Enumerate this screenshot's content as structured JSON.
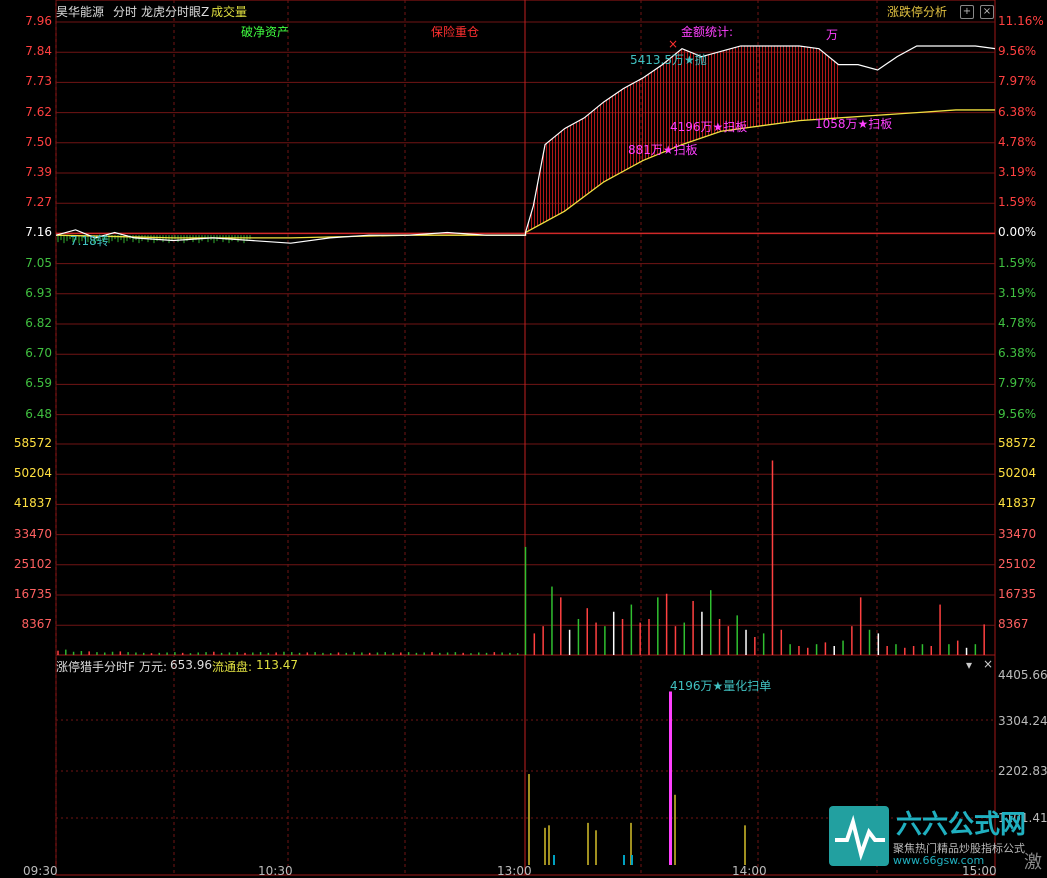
{
  "header": {
    "stock_name": "昊华能源",
    "view_mode": "分时",
    "indicator_name": "龙虎分时眼Z",
    "volume_label": "成交量",
    "analysis_button": "涨跌停分析",
    "add_button": "+",
    "close_button": "×"
  },
  "price_axis": {
    "labels": [
      "7.96",
      "7.84",
      "7.73",
      "7.62",
      "7.50",
      "7.39",
      "7.27",
      "7.16",
      "7.05",
      "6.93",
      "6.82",
      "6.70",
      "6.59",
      "6.48"
    ],
    "pct_labels": [
      "11.16%",
      "9.56%",
      "7.97%",
      "6.38%",
      "4.78%",
      "3.19%",
      "1.59%",
      "0.00%",
      "1.59%",
      "3.19%",
      "4.78%",
      "6.38%",
      "7.97%",
      "9.56%"
    ],
    "prev_close": 7.16,
    "up_color": "#ff4040",
    "down_color": "#40c040",
    "flat_color": "#ffffff"
  },
  "volume_axis": {
    "labels": [
      "58572",
      "50204",
      "41837",
      "33470",
      "25102",
      "16735",
      "8367"
    ]
  },
  "annotations": {
    "net_asset": "破净资产",
    "insurance": "保险重仓",
    "amount_stats": "金额统计:",
    "wan": "万",
    "buy_signal": "7.18转",
    "sell_signal": "5413.5万★抛",
    "sweep_1": "4196万★扫板",
    "sweep_2": "881万★扫板",
    "sweep_3": "1058万★扫板"
  },
  "indicator": {
    "title": "涨停猎手分时F",
    "wan_label": "万元:",
    "wan_value": "653.96",
    "float_label": "流通盘:",
    "float_value": "113.47",
    "axis_labels": [
      "4405.66",
      "3304.24",
      "2202.83",
      "1101.41"
    ],
    "quant_sweep": "4196万★量化扫单",
    "dropdown": "▾",
    "close": "×"
  },
  "time_axis": [
    "09:30",
    "10:30",
    "13:00",
    "14:00",
    "15:00"
  ],
  "watermark": {
    "brand": "六六公式网",
    "slogan": "聚焦热门精品炒股指标公式",
    "url": "www.66gsw.com",
    "footer_text": "激"
  },
  "chart_data": {
    "type": "line",
    "title": "",
    "ylim": [
      6.42,
      7.96
    ],
    "series": [
      {
        "name": "",
        "x": [
          "09:30",
          "09:35",
          "09:40",
          "09:45",
          "09:50",
          "10:00",
          "10:10",
          "10:20",
          "10:30",
          "10:40",
          "10:50",
          "11:00",
          "11:10",
          "11:20",
          "11:30",
          "13:00",
          "13:02",
          "13:05",
          "13:10",
          "13:15",
          "13:20",
          "13:25",
          "13:30",
          "13:35",
          "13:40",
          "13:45",
          "13:50",
          "13:55",
          "14:00",
          "14:05",
          "14:10",
          "14:15",
          "14:20",
          "14:25",
          "14:30",
          "14:35",
          "14:40",
          "14:45",
          "14:50",
          "14:55",
          "15:00"
        ],
        "values": [
          7.16,
          7.18,
          7.15,
          7.17,
          7.15,
          7.14,
          7.15,
          7.14,
          7.13,
          7.15,
          7.16,
          7.16,
          7.17,
          7.16,
          7.16,
          7.17,
          7.27,
          7.5,
          7.56,
          7.6,
          7.66,
          7.71,
          7.75,
          7.8,
          7.86,
          7.83,
          7.85,
          7.87,
          7.87,
          7.87,
          7.87,
          7.86,
          7.8,
          7.8,
          7.78,
          7.83,
          7.87,
          7.87,
          7.87,
          7.87,
          7.86
        ]
      },
      {
        "name": "",
        "x": [
          "09:30",
          "10:00",
          "10:30",
          "11:00",
          "11:30",
          "13:00",
          "13:10",
          "13:20",
          "13:30",
          "13:40",
          "13:50",
          "14:00",
          "14:10",
          "14:20",
          "14:30",
          "14:40",
          "14:50",
          "15:00"
        ],
        "values": [
          7.16,
          7.15,
          7.15,
          7.16,
          7.16,
          7.17,
          7.25,
          7.36,
          7.44,
          7.5,
          7.55,
          7.57,
          7.59,
          7.6,
          7.61,
          7.62,
          7.63,
          7.63
        ]
      }
    ],
    "volume": [
      1200,
      1500,
      900,
      1100,
      1000,
      800,
      700,
      900,
      1000,
      800,
      700,
      600,
      500,
      600,
      700,
      800,
      600,
      500,
      700,
      800,
      900,
      600,
      700,
      800,
      600,
      700,
      800,
      600,
      700,
      900,
      800,
      600,
      700,
      800,
      600,
      500,
      700,
      600,
      800,
      700,
      600,
      700,
      800,
      600,
      700,
      800,
      600,
      700,
      800,
      600,
      700,
      800,
      600,
      500,
      700,
      600,
      800,
      700,
      600,
      500,
      30000,
      6000,
      8000,
      19000,
      16000,
      7000,
      10000,
      13000,
      9000,
      8000,
      12000,
      10000,
      14000,
      9000,
      10000,
      16000,
      17000,
      8000,
      9000,
      15000,
      12000,
      18000,
      10000,
      8000,
      11000,
      7000,
      5000,
      6000,
      54000,
      7000,
      3000,
      2500,
      2000,
      3000,
      3500,
      2500,
      4000,
      8000,
      16000,
      7000,
      6000,
      2500,
      3000,
      2000,
      2500,
      3000,
      2500,
      14000,
      3000,
      4000,
      2000,
      3000,
      8500
    ],
    "indicator_bars": [
      2202,
      900,
      960,
      0,
      1020,
      840,
      0,
      1020,
      0,
      4200,
      1700,
      960
    ],
    "indicator_bar_colors": [
      "#a09020",
      "#a09020",
      "#a09020",
      "#00a0c0",
      "#a09020",
      "#a09020",
      "#00a0c0",
      "#a09020",
      "#00a0c0",
      "#ff40ff",
      "#a09020",
      "#a09020"
    ]
  }
}
